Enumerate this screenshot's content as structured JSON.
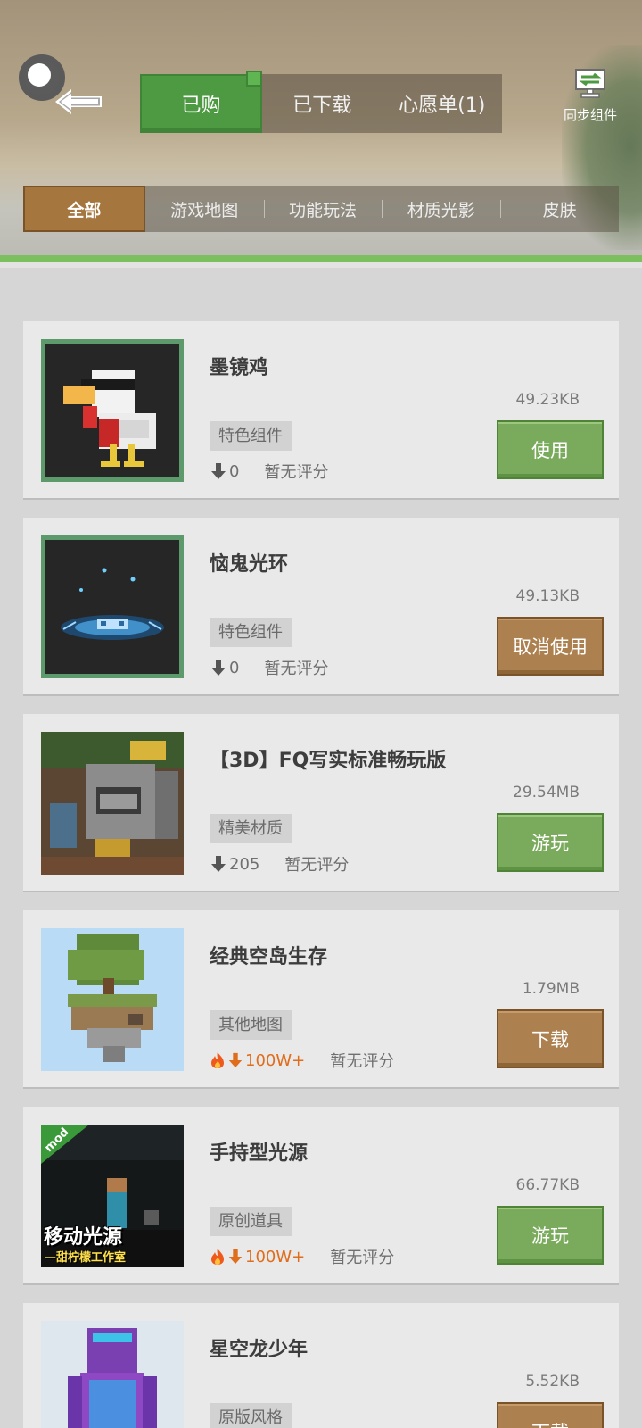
{
  "header": {
    "tabs": [
      {
        "label": "已购",
        "active": true
      },
      {
        "label": "已下载",
        "active": false
      },
      {
        "label": "心愿单(1)",
        "active": false
      }
    ],
    "sync_label": "同步组件"
  },
  "filters": [
    {
      "label": "全部",
      "active": true
    },
    {
      "label": "游戏地图",
      "active": false
    },
    {
      "label": "功能玩法",
      "active": false
    },
    {
      "label": "材质光影",
      "active": false
    },
    {
      "label": "皮肤",
      "active": false
    }
  ],
  "items": [
    {
      "title": "墨镜鸡",
      "size": "49.23KB",
      "tag": "特色组件",
      "downloads": "0",
      "rating": "暂无评分",
      "action": "使用",
      "action_style": "green",
      "hot": false,
      "thumb_icon": "sunglasses-chicken"
    },
    {
      "title": "恼鬼光环",
      "size": "49.13KB",
      "tag": "特色组件",
      "downloads": "0",
      "rating": "暂无评分",
      "action": "取消使用",
      "action_style": "brown",
      "hot": false,
      "thumb_icon": "ghost-halo"
    },
    {
      "title": "【3D】FQ写实标准畅玩版",
      "size": "29.54MB",
      "tag": "精美材质",
      "downloads": "205",
      "rating": "暂无评分",
      "action": "游玩",
      "action_style": "green",
      "hot": false,
      "thumb_icon": "furnace-block"
    },
    {
      "title": "经典空岛生存",
      "size": "1.79MB",
      "tag": "其他地图",
      "downloads": "100W+",
      "rating": "暂无评分",
      "action": "下载",
      "action_style": "brown",
      "hot": true,
      "thumb_icon": "sky-island"
    },
    {
      "title": "手持型光源",
      "size": "66.77KB",
      "tag": "原创道具",
      "downloads": "100W+",
      "rating": "暂无评分",
      "action": "游玩",
      "action_style": "green",
      "hot": true,
      "thumb_icon": "mod-light",
      "thumb_text": "移动光源",
      "thumb_sub": "—甜柠檬工作室",
      "thumb_badge": "mod"
    },
    {
      "title": "星空龙少年",
      "size": "5.52KB",
      "tag": "原版风格",
      "downloads": "",
      "rating": "",
      "action": "下载",
      "action_style": "brown",
      "hot": false,
      "thumb_icon": "starry-skin"
    }
  ],
  "colors": {
    "green": "#7aab5c",
    "brown": "#ad8050",
    "hot": "#e06d1c"
  }
}
